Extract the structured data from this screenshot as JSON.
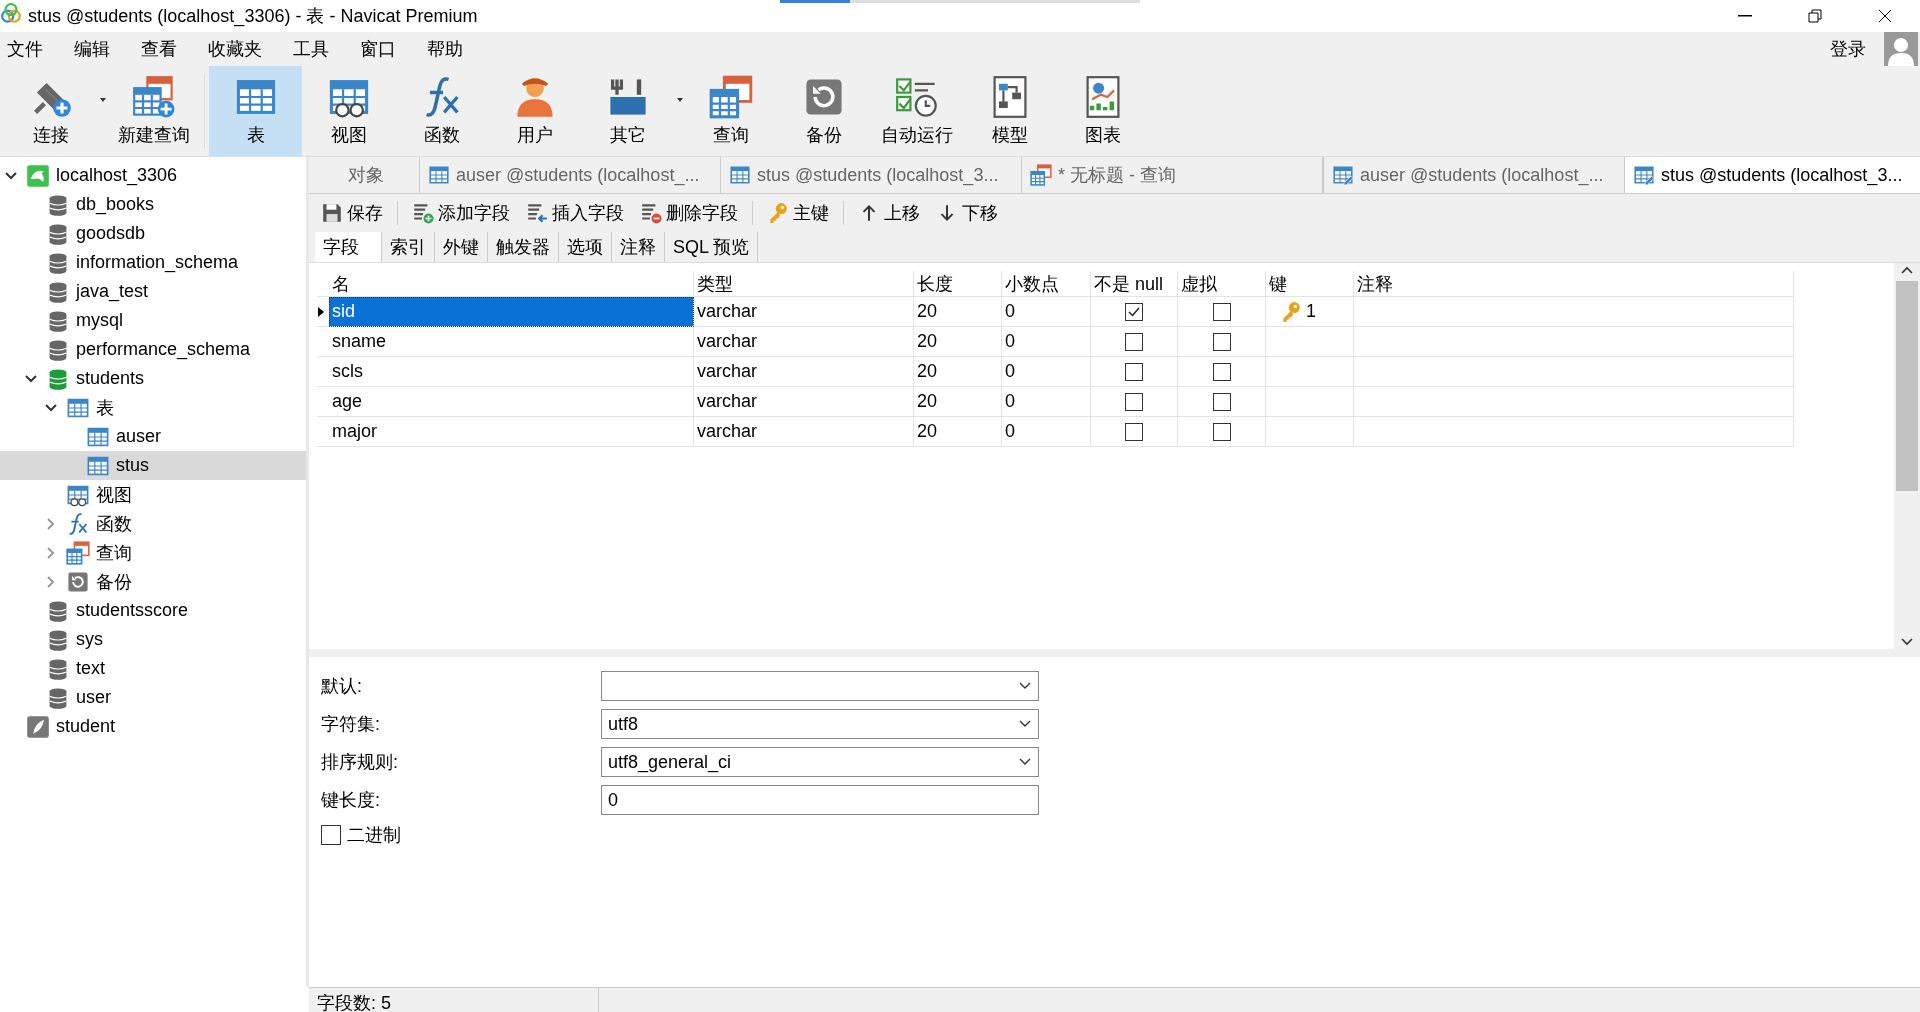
{
  "window": {
    "title": "stus @students (localhost_3306) - 表 - Navicat Premium"
  },
  "menu": [
    "文件",
    "编辑",
    "查看",
    "收藏夹",
    "工具",
    "窗口",
    "帮助"
  ],
  "login": "登录",
  "toolbar": [
    {
      "label": "连接",
      "kind": "connect",
      "dropdown": true,
      "selected": false
    },
    {
      "label": "新建查询",
      "kind": "newquery",
      "dropdown": false,
      "selected": false
    },
    {
      "label": "表",
      "kind": "table",
      "dropdown": false,
      "selected": true
    },
    {
      "label": "视图",
      "kind": "view",
      "dropdown": false,
      "selected": false
    },
    {
      "label": "函数",
      "kind": "func",
      "dropdown": false,
      "selected": false
    },
    {
      "label": "用户",
      "kind": "user",
      "dropdown": false,
      "selected": false
    },
    {
      "label": "其它",
      "kind": "tools",
      "dropdown": true,
      "selected": false
    },
    {
      "label": "查询",
      "kind": "query",
      "dropdown": false,
      "selected": false
    },
    {
      "label": "备份",
      "kind": "backup",
      "dropdown": false,
      "selected": false
    },
    {
      "label": "自动运行",
      "kind": "schedule",
      "dropdown": false,
      "selected": false
    },
    {
      "label": "模型",
      "kind": "model",
      "dropdown": false,
      "selected": false
    },
    {
      "label": "图表",
      "kind": "chart",
      "dropdown": false,
      "selected": false
    }
  ],
  "tree": [
    {
      "label": "localhost_3306",
      "kind": "server",
      "expanded": true,
      "selected": false,
      "children": [
        {
          "label": "db_books",
          "kind": "db",
          "selected": false
        },
        {
          "label": "goodsdb",
          "kind": "db",
          "selected": false
        },
        {
          "label": "information_schema",
          "kind": "db",
          "selected": false
        },
        {
          "label": "java_test",
          "kind": "db",
          "selected": false
        },
        {
          "label": "mysql",
          "kind": "db",
          "selected": false
        },
        {
          "label": "performance_schema",
          "kind": "db",
          "selected": false
        },
        {
          "label": "students",
          "kind": "dbopen",
          "expanded": true,
          "selected": false,
          "children": [
            {
              "label": "表",
              "kind": "table",
              "expanded": true,
              "selected": false,
              "children": [
                {
                  "label": "auser",
                  "kind": "table",
                  "selected": false
                },
                {
                  "label": "stus",
                  "kind": "table",
                  "selected": true
                }
              ]
            },
            {
              "label": "视图",
              "kind": "view",
              "selected": false
            },
            {
              "label": "函数",
              "kind": "func",
              "expanded": false,
              "selected": false
            },
            {
              "label": "查询",
              "kind": "query",
              "expanded": false,
              "selected": false
            },
            {
              "label": "备份",
              "kind": "backup",
              "expanded": false,
              "selected": false
            }
          ]
        },
        {
          "label": "studentsscore",
          "kind": "db",
          "selected": false
        },
        {
          "label": "sys",
          "kind": "db",
          "selected": false
        },
        {
          "label": "text",
          "kind": "db",
          "selected": false
        },
        {
          "label": "user",
          "kind": "db",
          "selected": false
        }
      ]
    },
    {
      "label": "student",
      "kind": "sqlite",
      "selected": false
    }
  ],
  "tabs": [
    {
      "label": "对象",
      "kind": "object",
      "selected": false
    },
    {
      "label": "auser @students (localhost_...",
      "kind": "table",
      "selected": false
    },
    {
      "label": "stus @students (localhost_3...",
      "kind": "table",
      "selected": false
    },
    {
      "label": "* 无标题 - 查询",
      "kind": "query",
      "selected": false
    },
    {
      "label": "auser @students (localhost_...",
      "kind": "design",
      "selected": false
    },
    {
      "label": "stus @students (localhost_3...",
      "kind": "design",
      "selected": true
    }
  ],
  "editor_toolbar": [
    {
      "label": "保存",
      "kind": "save"
    },
    {
      "label": "添加字段",
      "kind": "add"
    },
    {
      "label": "插入字段",
      "kind": "insert"
    },
    {
      "label": "删除字段",
      "kind": "delete"
    },
    {
      "label": "主键",
      "kind": "key"
    },
    {
      "label": "上移",
      "kind": "up"
    },
    {
      "label": "下移",
      "kind": "down"
    }
  ],
  "subtabs": [
    {
      "label": "字段",
      "selected": true
    },
    {
      "label": "索引",
      "selected": false
    },
    {
      "label": "外键",
      "selected": false
    },
    {
      "label": "触发器",
      "selected": false
    },
    {
      "label": "选项",
      "selected": false
    },
    {
      "label": "注释",
      "selected": false
    },
    {
      "label": "SQL 预览",
      "selected": false
    }
  ],
  "columns": [
    "名",
    "类型",
    "长度",
    "小数点",
    "不是 null",
    "虚拟",
    "键",
    "注释"
  ],
  "rows": [
    {
      "name": "sid",
      "type": "varchar",
      "length": "20",
      "decimals": "0",
      "not_null": true,
      "virtual": false,
      "key": "1",
      "selected": true
    },
    {
      "name": "sname",
      "type": "varchar",
      "length": "20",
      "decimals": "0",
      "not_null": false,
      "virtual": false,
      "selected": false
    },
    {
      "name": "scls",
      "type": "varchar",
      "length": "20",
      "decimals": "0",
      "not_null": false,
      "virtual": false,
      "selected": false
    },
    {
      "name": "age",
      "type": "varchar",
      "length": "20",
      "decimals": "0",
      "not_null": false,
      "virtual": false,
      "selected": false
    },
    {
      "name": "major",
      "type": "varchar",
      "length": "20",
      "decimals": "0",
      "not_null": false,
      "virtual": false,
      "selected": false
    }
  ],
  "properties": [
    {
      "label": "默认:",
      "kind": "select"
    },
    {
      "label": "字符集:",
      "kind": "select",
      "value": "utf8"
    },
    {
      "label": "排序规则:",
      "kind": "select",
      "value": "utf8_general_ci"
    },
    {
      "label": "键长度:",
      "kind": "input",
      "value": "0"
    }
  ],
  "binary": {
    "label": "二进制",
    "checked": false
  },
  "status": "字段数: 5"
}
